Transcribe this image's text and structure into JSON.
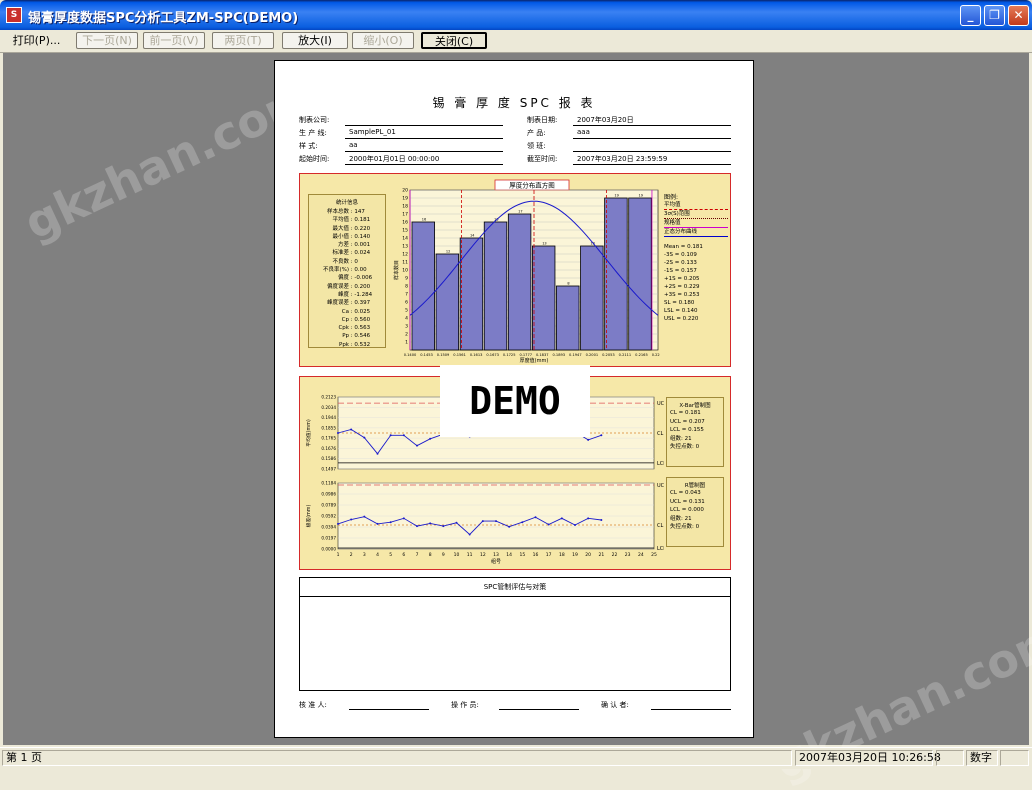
{
  "window": {
    "title": "锡膏厚度数据SPC分析工具ZM-SPC(DEMO)"
  },
  "toolbar": {
    "print": "打印(P)...",
    "next_page": "下一页(N)",
    "prev_page": "前一页(V)",
    "two_page": "两页(T)",
    "zoom_in": "放大(I)",
    "zoom_out": "缩小(O)",
    "close": "关闭(C)"
  },
  "watermark": {
    "text": "gkzhan.com"
  },
  "report": {
    "title": "锡 膏 厚 度 SPC 报 表",
    "header": {
      "company_label": "制表公司:",
      "company_value": "",
      "date_label": "制表日期:",
      "date_value": "2007年03月20日",
      "line_label": "生 产 线:",
      "line_value": "SamplePL_01",
      "product_label": "产    品:",
      "product_value": "aaa",
      "sample_label": "样    式:",
      "sample_value": "aa",
      "team_label": "领    班:",
      "team_value": "",
      "start_label": "起始时间:",
      "start_value": "2000年01月01日 00:00:00",
      "end_label": "截至时间:",
      "end_value": "2007年03月20日 23:59:59"
    },
    "histogram_title": "厚度分布直方图",
    "stats_title": "统计信息",
    "stats": [
      {
        "label": "样本总数",
        "value": "147"
      },
      {
        "label": "平均值",
        "value": "0.181"
      },
      {
        "label": "最大值",
        "value": "0.220"
      },
      {
        "label": "最小值",
        "value": "0.140"
      },
      {
        "label": "方差",
        "value": "0.001"
      },
      {
        "label": "标准差",
        "value": "0.024"
      },
      {
        "label": "不良数",
        "value": "0"
      },
      {
        "label": "不良率(%)",
        "value": "0.00"
      },
      {
        "label": "偏度",
        "value": "-0.006"
      },
      {
        "label": "偏度误差",
        "value": "0.200"
      },
      {
        "label": "峰度",
        "value": "-1.284"
      },
      {
        "label": "峰度误差",
        "value": "0.397"
      },
      {
        "label": "Ca",
        "value": "0.025"
      },
      {
        "label": "Cp",
        "value": "0.560"
      },
      {
        "label": "Cpk",
        "value": "0.563"
      },
      {
        "label": "Pp",
        "value": "0.546"
      },
      {
        "label": "Ppk",
        "value": "0.532"
      }
    ],
    "legend_title": "图例:",
    "legend_items": [
      "平均值",
      "3σ(S)范围",
      "规格值",
      "正态分布曲线"
    ],
    "legend_values": [
      "Mean = 0.181",
      "-3S = 0.109",
      "-2S = 0.133",
      "-1S = 0.157",
      "+1S = 0.205",
      "+2S = 0.229",
      "+3S = 0.253",
      "SL = 0.180",
      "LSL = 0.140",
      "USL = 0.220"
    ],
    "xbar_box": {
      "title": "X-Bar管制图",
      "rows": [
        "CL  = 0.181",
        "UCL = 0.207",
        "LCL = 0.155",
        "组数: 21",
        "失控点数: 0"
      ]
    },
    "r_box": {
      "title": "R管制图",
      "rows": [
        "CL  = 0.043",
        "UCL = 0.131",
        "LCL = 0.000",
        "组数: 21",
        "失控点数: 0"
      ]
    },
    "control_labels": {
      "ucl": "UCL",
      "cl": "CL",
      "lcl": "LCL",
      "xlabel": "组号",
      "ylabel_x": "平均值(mm)",
      "ylabel_r": "极差(mm)"
    },
    "demo_stamp": "DEMO",
    "evaluation_title": "SPC管制评估与对策",
    "footer": {
      "approver": "核 准 人:",
      "operator": "操 作 员:",
      "confirmer": "确 认 者:"
    }
  },
  "chart_data": [
    {
      "type": "bar",
      "title": "厚度分布直方图",
      "xlabel": "厚度值(mm)",
      "ylabel": "样本数目",
      "categories": [
        "0.1400",
        "0.1453",
        "0.1509",
        "0.1561",
        "0.1613",
        "0.1673",
        "0.1725",
        "0.1777",
        "0.1837",
        "0.1893",
        "0.1947",
        "0.2001",
        "0.2053",
        "0.2111",
        "0.2165",
        "0.2220"
      ],
      "values": [
        16,
        12,
        14,
        16,
        17,
        13,
        8,
        13,
        19,
        19
      ],
      "ylim": [
        0,
        20
      ],
      "yticks": [
        1,
        2,
        3,
        4,
        5,
        6,
        7,
        8,
        9,
        10,
        11,
        12,
        13,
        14,
        15,
        16,
        17,
        18,
        19,
        20
      ]
    },
    {
      "type": "line",
      "title": "X-Bar",
      "ylabel": "平均值(mm)",
      "yticks": [
        "0.2123",
        "0.2034",
        "0.1944",
        "0.1855",
        "0.1765",
        "0.1676",
        "0.1586",
        "0.1497"
      ],
      "ylim": [
        0.1497,
        0.2123
      ],
      "ucl": 0.207,
      "cl": 0.181,
      "lcl": 0.155,
      "x": [
        1,
        2,
        3,
        4,
        5,
        6,
        7,
        8,
        9,
        10,
        11,
        12,
        13,
        14,
        15,
        16,
        17,
        18,
        19,
        20,
        21
      ],
      "values": [
        0.181,
        0.184,
        0.177,
        0.163,
        0.179,
        0.179,
        0.17,
        0.176,
        0.18,
        0.18,
        0.178,
        0.18,
        0.181,
        0.183,
        0.185,
        0.182,
        0.183,
        0.185,
        0.182,
        0.175,
        0.179
      ]
    },
    {
      "type": "line",
      "title": "R",
      "xlabel": "组号",
      "ylabel": "极差(mm)",
      "yticks": [
        "0.1184",
        "0.0986",
        "0.0789",
        "0.0592",
        "0.0394",
        "0.0197",
        "0.0000"
      ],
      "ylim": [
        0,
        0.1184
      ],
      "ucl": 0.131,
      "cl": 0.043,
      "lcl": 0.0,
      "x": [
        1,
        2,
        3,
        4,
        5,
        6,
        7,
        8,
        9,
        10,
        11,
        12,
        13,
        14,
        15,
        16,
        17,
        18,
        19,
        20,
        21
      ],
      "values": [
        0.045,
        0.053,
        0.058,
        0.045,
        0.048,
        0.055,
        0.041,
        0.046,
        0.041,
        0.047,
        0.026,
        0.05,
        0.05,
        0.04,
        0.048,
        0.057,
        0.044,
        0.055,
        0.043,
        0.055,
        0.052
      ],
      "xticks": [
        "1",
        "2",
        "3",
        "4",
        "5",
        "6",
        "7",
        "8",
        "9",
        "10",
        "11",
        "12",
        "13",
        "14",
        "15",
        "16",
        "17",
        "18",
        "19",
        "20",
        "21",
        "22",
        "23",
        "24",
        "25"
      ]
    }
  ],
  "status": {
    "page": "第 1 页",
    "datetime": "2007年03月20日 10:26:58",
    "mode": "数字"
  }
}
